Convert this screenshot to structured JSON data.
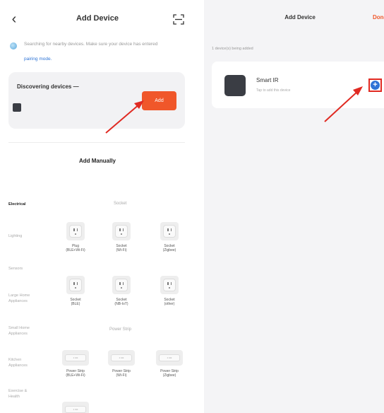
{
  "left": {
    "header": {
      "back_icon": "chevron-left-icon",
      "title": "Add Device",
      "scan_icon": "scan-icon"
    },
    "notice": {
      "text": "Searching for nearby devices. Make sure your device has entered",
      "link": "pairing mode."
    },
    "discovering": {
      "title": "Discovering devices —",
      "add_label": "Add"
    },
    "manual_title": "Add Manually",
    "categories": [
      {
        "label": "Electrical",
        "active": true
      },
      {
        "label": "Lighting",
        "active": false
      },
      {
        "label": "Sensors",
        "active": false
      },
      {
        "label": "Large Home Appliances",
        "active": false
      },
      {
        "label": "Small Home Appliances",
        "active": false
      },
      {
        "label": "Kitchen Appliances",
        "active": false
      },
      {
        "label": "Exercise & Health",
        "active": false
      }
    ],
    "sections": [
      {
        "title": "Socket"
      },
      {
        "title": "Power Strip"
      }
    ],
    "sockets": [
      {
        "label": "Plug",
        "sub": "(BLE+Wi-Fi)"
      },
      {
        "label": "Socket",
        "sub": "(Wi-Fi)"
      },
      {
        "label": "Socket",
        "sub": "(Zigbee)"
      },
      {
        "label": "Socket",
        "sub": "(BLE)"
      },
      {
        "label": "Socket",
        "sub": "(NB-IoT)"
      },
      {
        "label": "Socket",
        "sub": "(other)"
      }
    ],
    "strips": [
      {
        "label": "Power Strip",
        "sub": "(BLE+Wi-Fi)"
      },
      {
        "label": "Power Strip",
        "sub": "(Wi-Fi)"
      },
      {
        "label": "Power Strip",
        "sub": "(Zigbee)"
      }
    ]
  },
  "right": {
    "title": "Add Device",
    "done_label": "Done",
    "added_count": "1 device(s) being added",
    "device": {
      "name": "Smart IR",
      "sub": "Tap to add this device",
      "add_icon": "plus-circle-icon"
    }
  },
  "colors": {
    "accent": "#f0572a",
    "link": "#2f74d6",
    "annotation": "#e02a22",
    "device": "#3a3d44"
  }
}
